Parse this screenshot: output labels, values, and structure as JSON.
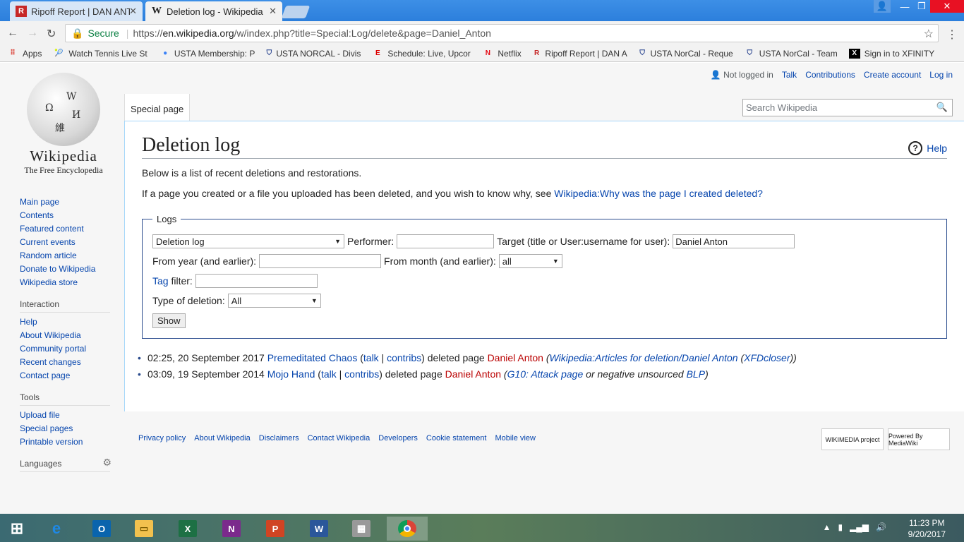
{
  "browser": {
    "tabs": [
      {
        "title": "Ripoff Report | DAN ANT",
        "favicon": "R",
        "active": false
      },
      {
        "title": "Deletion log - Wikipedia",
        "favicon": "W",
        "active": true
      }
    ],
    "secure_label": "Secure",
    "url_scheme": "https://",
    "url_host": "en.wikipedia.org",
    "url_path": "/w/index.php?title=Special:Log/delete&page=Daniel_Anton",
    "bookmarks": [
      {
        "label": "Apps",
        "icon": "apps-grid-icon"
      },
      {
        "label": "Watch Tennis Live St",
        "icon": "tennis-icon"
      },
      {
        "label": "USTA Membership: P",
        "icon": "usta-icon"
      },
      {
        "label": "USTA NORCAL - Divis",
        "icon": "usta-shield-icon"
      },
      {
        "label": "Schedule: Live, Upcor",
        "icon": "espn-icon"
      },
      {
        "label": "Netflix",
        "icon": "netflix-icon"
      },
      {
        "label": "Ripoff Report | DAN A",
        "icon": "ripoff-icon"
      },
      {
        "label": "USTA NorCal - Reque",
        "icon": "usta-shield-icon"
      },
      {
        "label": "USTA NorCal - Team",
        "icon": "usta-shield-icon"
      },
      {
        "label": "Sign in to XFINITY",
        "icon": "xfinity-icon"
      }
    ]
  },
  "personal": {
    "not_logged_in": "Not logged in",
    "talk": "Talk",
    "contributions": "Contributions",
    "create_account": "Create account",
    "log_in": "Log in"
  },
  "logo": {
    "wordmark": "Wikipedia",
    "tagline": "The Free Encyclopedia"
  },
  "sidebar": {
    "main": [
      "Main page",
      "Contents",
      "Featured content",
      "Current events",
      "Random article",
      "Donate to Wikipedia",
      "Wikipedia store"
    ],
    "interaction_heading": "Interaction",
    "interaction": [
      "Help",
      "About Wikipedia",
      "Community portal",
      "Recent changes",
      "Contact page"
    ],
    "tools_heading": "Tools",
    "tools": [
      "Upload file",
      "Special pages",
      "Printable version"
    ],
    "languages_heading": "Languages"
  },
  "special_tab": "Special page",
  "search_placeholder": "Search Wikipedia",
  "content": {
    "title": "Deletion log",
    "help": "Help",
    "intro": "Below is a list of recent deletions and restorations.",
    "why_prefix": "If a page you created or a file you uploaded has been deleted, and you wish to know why, see ",
    "why_link": "Wikipedia:Why was the page I created deleted?",
    "form": {
      "legend": "Logs",
      "log_type": "Deletion log",
      "performer_label": "Performer:",
      "performer_value": "",
      "target_label": "Target (title or User:username for user):",
      "target_value": "Daniel Anton",
      "year_label": "From year (and earlier):",
      "year_value": "",
      "month_label": "From month (and earlier):",
      "month_value": "all",
      "tag_link": "Tag",
      "tag_label": " filter:",
      "tag_value": "",
      "deletion_type_label": "Type of deletion:",
      "deletion_type_value": "All",
      "show_button": "Show"
    },
    "entries": [
      {
        "time": "02:25, 20 September 2017",
        "user": "Premeditated Chaos",
        "talk": "talk",
        "contribs": "contribs",
        "action": " deleted page ",
        "page": "Daniel Anton",
        "reason_link": "Wikipedia:Articles for deletion/Daniel Anton",
        "reason_extra": "XFDcloser"
      },
      {
        "time": "03:09, 19 September 2014",
        "user": "Mojo Hand",
        "talk": "talk",
        "contribs": "contribs",
        "action": " deleted page ",
        "page": "Daniel Anton",
        "reason_link": "G10: Attack page",
        "reason_mid": " or negative unsourced ",
        "reason_extra": "BLP"
      }
    ]
  },
  "footer": {
    "links": [
      "Privacy policy",
      "About Wikipedia",
      "Disclaimers",
      "Contact Wikipedia",
      "Developers",
      "Cookie statement",
      "Mobile view"
    ],
    "wikimedia_badge": "WIKIMEDIA project",
    "mediawiki_badge": "Powered By MediaWiki"
  },
  "taskbar": {
    "time": "11:23 PM",
    "date": "9/20/2017"
  }
}
